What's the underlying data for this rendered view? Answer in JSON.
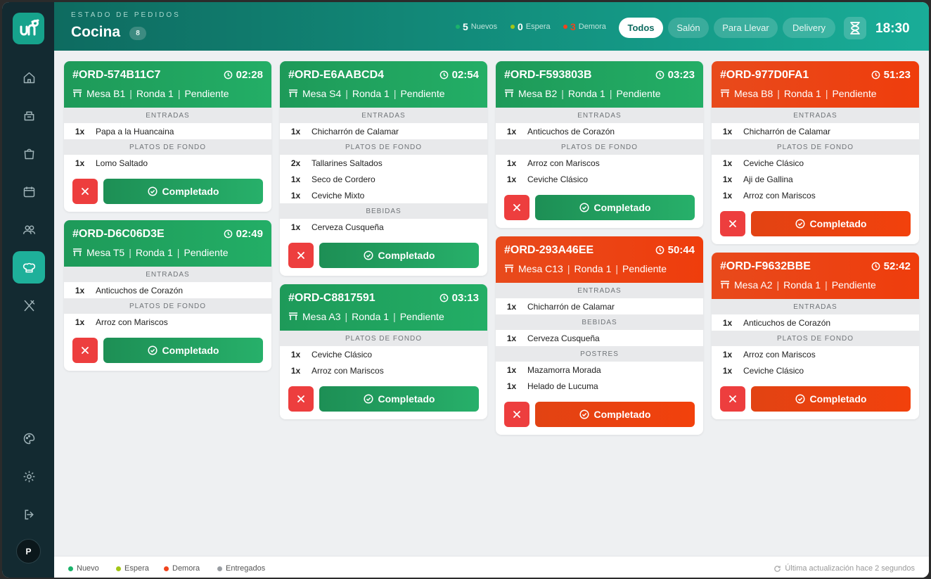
{
  "header": {
    "subtitle": "ESTADO DE PEDIDOS",
    "title": "Cocina",
    "badge": "8",
    "stats": [
      {
        "count": "5",
        "label": "Nuevos",
        "color": "#1bb36b"
      },
      {
        "count": "0",
        "label": "Espera",
        "color": "#a3c617"
      },
      {
        "count": "3",
        "label": "Demora",
        "color": "#f0441e"
      }
    ],
    "filters": [
      "Todos",
      "Salón",
      "Para Llevar",
      "Delivery"
    ],
    "active_filter": "Todos",
    "clock": "18:30"
  },
  "sidebar": {
    "logo_icon": "logo-icon",
    "items": [
      "home-icon",
      "delivery-box-icon",
      "bag-icon",
      "calendar-icon",
      "users-icon",
      "chef-hat-icon",
      "utensils-icon"
    ],
    "bottom_items": [
      "palette-icon",
      "gear-icon",
      "logout-icon"
    ],
    "avatar": "P"
  },
  "orders": [
    {
      "id": "#ORD-574B11C7",
      "time": "02:28",
      "table": "Mesa B1",
      "round": "Ronda 1",
      "status": "Pendiente",
      "color": "green",
      "sections": [
        {
          "name": "ENTRADAS",
          "items": [
            {
              "qty": "1x",
              "name": "Papa a la Huancaina"
            }
          ]
        },
        {
          "name": "PLATOS DE FONDO",
          "items": [
            {
              "qty": "1x",
              "name": "Lomo Saltado"
            }
          ]
        }
      ]
    },
    {
      "id": "#ORD-D6C06D3E",
      "time": "02:49",
      "table": "Mesa T5",
      "round": "Ronda 1",
      "status": "Pendiente",
      "color": "green",
      "sections": [
        {
          "name": "ENTRADAS",
          "items": [
            {
              "qty": "1x",
              "name": "Anticuchos de Corazón"
            }
          ]
        },
        {
          "name": "PLATOS DE FONDO",
          "items": [
            {
              "qty": "1x",
              "name": "Arroz con Mariscos"
            }
          ]
        }
      ]
    },
    {
      "id": "#ORD-E6AABCD4",
      "time": "02:54",
      "table": "Mesa S4",
      "round": "Ronda 1",
      "status": "Pendiente",
      "color": "green",
      "sections": [
        {
          "name": "ENTRADAS",
          "items": [
            {
              "qty": "1x",
              "name": "Chicharrón de Calamar"
            }
          ]
        },
        {
          "name": "PLATOS DE FONDO",
          "items": [
            {
              "qty": "2x",
              "name": "Tallarines Saltados"
            },
            {
              "qty": "1x",
              "name": "Seco de Cordero"
            },
            {
              "qty": "1x",
              "name": "Ceviche Mixto"
            }
          ]
        },
        {
          "name": "BEBIDAS",
          "items": [
            {
              "qty": "1x",
              "name": "Cerveza Cusqueña"
            }
          ]
        }
      ]
    },
    {
      "id": "#ORD-C8817591",
      "time": "03:13",
      "table": "Mesa A3",
      "round": "Ronda 1",
      "status": "Pendiente",
      "color": "green",
      "sections": [
        {
          "name": "PLATOS DE FONDO",
          "items": [
            {
              "qty": "1x",
              "name": "Ceviche Clásico"
            },
            {
              "qty": "1x",
              "name": "Arroz con Mariscos"
            }
          ]
        }
      ]
    },
    {
      "id": "#ORD-F593803B",
      "time": "03:23",
      "table": "Mesa B2",
      "round": "Ronda 1",
      "status": "Pendiente",
      "color": "green",
      "sections": [
        {
          "name": "ENTRADAS",
          "items": [
            {
              "qty": "1x",
              "name": "Anticuchos de Corazón"
            }
          ]
        },
        {
          "name": "PLATOS DE FONDO",
          "items": [
            {
              "qty": "1x",
              "name": "Arroz con Mariscos"
            },
            {
              "qty": "1x",
              "name": "Ceviche Clásico"
            }
          ]
        }
      ]
    },
    {
      "id": "#ORD-293A46EE",
      "time": "50:44",
      "table": "Mesa C13",
      "round": "Ronda 1",
      "status": "Pendiente",
      "color": "red",
      "sections": [
        {
          "name": "ENTRADAS",
          "items": [
            {
              "qty": "1x",
              "name": "Chicharrón de Calamar"
            }
          ]
        },
        {
          "name": "BEBIDAS",
          "items": [
            {
              "qty": "1x",
              "name": "Cerveza Cusqueña"
            }
          ]
        },
        {
          "name": "POSTRES",
          "items": [
            {
              "qty": "1x",
              "name": "Mazamorra Morada"
            },
            {
              "qty": "1x",
              "name": "Helado de Lucuma"
            }
          ]
        }
      ]
    },
    {
      "id": "#ORD-977D0FA1",
      "time": "51:23",
      "table": "Mesa B8",
      "round": "Ronda 1",
      "status": "Pendiente",
      "color": "red",
      "sections": [
        {
          "name": "ENTRADAS",
          "items": [
            {
              "qty": "1x",
              "name": "Chicharrón de Calamar"
            }
          ]
        },
        {
          "name": "PLATOS DE FONDO",
          "items": [
            {
              "qty": "1x",
              "name": "Ceviche Clásico"
            },
            {
              "qty": "1x",
              "name": "Aji de Gallina"
            },
            {
              "qty": "1x",
              "name": "Arroz con Mariscos"
            }
          ]
        }
      ]
    },
    {
      "id": "#ORD-F9632BBE",
      "time": "52:42",
      "table": "Mesa A2",
      "round": "Ronda 1",
      "status": "Pendiente",
      "color": "red",
      "sections": [
        {
          "name": "ENTRADAS",
          "items": [
            {
              "qty": "1x",
              "name": "Anticuchos de Corazón"
            }
          ]
        },
        {
          "name": "PLATOS DE FONDO",
          "items": [
            {
              "qty": "1x",
              "name": "Arroz con Mariscos"
            },
            {
              "qty": "1x",
              "name": "Ceviche Clásico"
            }
          ]
        }
      ]
    }
  ],
  "buttons": {
    "complete_label": "Completado",
    "cancel_icon": "close-icon"
  },
  "footer": {
    "legend": [
      {
        "label": "Nuevo",
        "color": "#1bb36b"
      },
      {
        "label": "Espera",
        "color": "#a3c617"
      },
      {
        "label": "Demora",
        "color": "#f0441e"
      },
      {
        "label": "Entregados",
        "color": "#9a9ea3"
      }
    ],
    "updated": "Última actualización hace 2 segundos"
  }
}
